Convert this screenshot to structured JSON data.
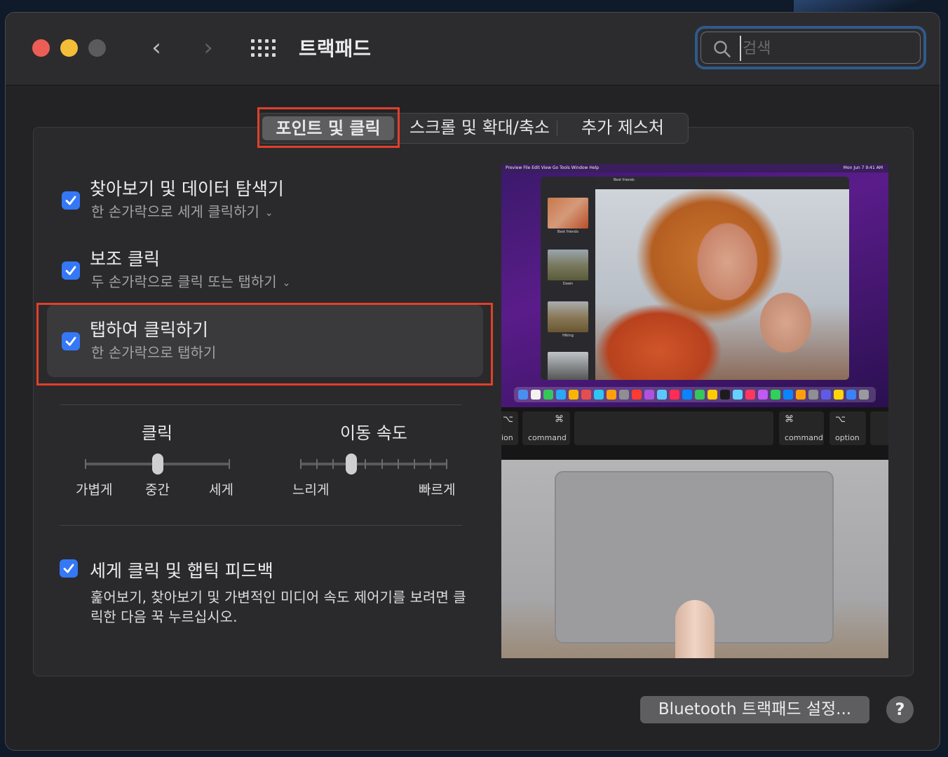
{
  "window": {
    "title": "트랙패드"
  },
  "titlebar": {
    "back_icon": "chevron-left-icon",
    "forward_icon": "chevron-right-icon",
    "grid_icon": "show-all-grid-icon",
    "back_glyph": "‹",
    "forward_glyph": "›"
  },
  "search": {
    "placeholder": "검색",
    "value": ""
  },
  "tabs": [
    {
      "label": "포인트 및 클릭",
      "selected": true
    },
    {
      "label": "스크롤 및 확대/축소",
      "selected": false
    },
    {
      "label": "추가 제스처",
      "selected": false
    }
  ],
  "options": [
    {
      "title": "찾아보기 및 데이터 탐색기",
      "subtitle": "한 손가락으로 세게 클릭하기",
      "checked": true,
      "has_dropdown": true
    },
    {
      "title": "보조 클릭",
      "subtitle": "두 손가락으로 클릭 또는 탭하기",
      "checked": true,
      "has_dropdown": true
    },
    {
      "title": "탭하여 클릭하기",
      "subtitle": "한 손가락으로 탭하기",
      "checked": true,
      "has_dropdown": false
    }
  ],
  "sliders": {
    "click": {
      "label": "클릭",
      "ticks": [
        "가볍게",
        "중간",
        "세게"
      ],
      "value": "중간"
    },
    "speed": {
      "label": "이동 속도",
      "min_label": "느리게",
      "max_label": "빠르게",
      "tick_count": 10,
      "value_index": 3
    }
  },
  "haptic": {
    "title": "세게 클릭 및 햅틱 피드백",
    "description": "훑어보기, 찾아보기 및 가변적인 미디어 속도 제어기를 보려면 클릭한 다음 꾹 누르십시오.",
    "checked": true
  },
  "preview": {
    "menu": "Preview  File  Edit  View  Go  Tools  Window  Help",
    "clock": "Mon Jun 7  9:41 AM",
    "doc_title": "Best friends",
    "thumbs": [
      "Best friends",
      "Dawn",
      "Hiking",
      ""
    ],
    "keys": [
      {
        "symbol": "⌥",
        "label": "ion"
      },
      {
        "symbol": "⌘",
        "label": "command"
      },
      {
        "symbol": "⌘",
        "label": "command"
      },
      {
        "symbol": "⌥",
        "label": "option"
      }
    ]
  },
  "footer": {
    "bluetooth_button": "Bluetooth 트랙패드 설정...",
    "help_button": "?"
  },
  "colors": {
    "accent": "#3478f6",
    "highlight": "#e0402a",
    "close": "#ed5d56",
    "minimize": "#f3bd3a"
  }
}
